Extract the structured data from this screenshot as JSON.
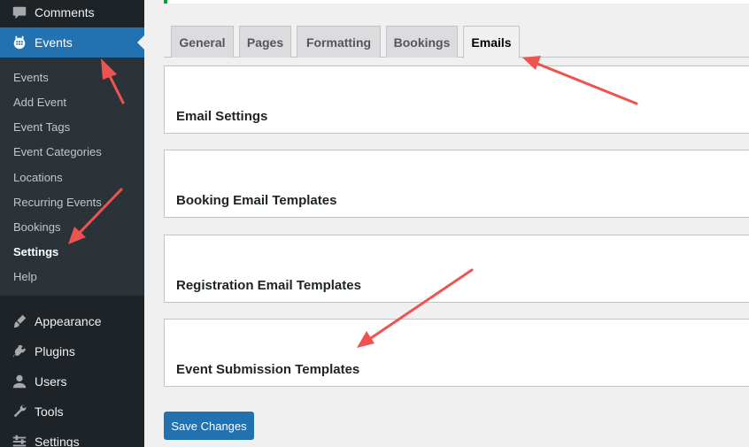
{
  "sidebar": {
    "items": {
      "comments": "Comments",
      "events": "Events",
      "appearance": "Appearance",
      "plugins": "Plugins",
      "users": "Users",
      "tools": "Tools",
      "settings": "Settings"
    },
    "events_submenu": [
      "Events",
      "Add Event",
      "Event Tags",
      "Event Categories",
      "Locations",
      "Recurring Events",
      "Bookings",
      "Settings",
      "Help"
    ]
  },
  "tabs": [
    "General",
    "Pages",
    "Formatting",
    "Bookings",
    "Emails"
  ],
  "active_tab": "Emails",
  "panels": [
    "Email Settings",
    "Booking Email Templates",
    "Registration Email Templates",
    "Event Submission Templates"
  ],
  "save_label": "Save Changes",
  "colors": {
    "admin_blue": "#2271b1",
    "sidebar_bg": "#1d2327",
    "annotation_arrow": "#ef5350"
  }
}
